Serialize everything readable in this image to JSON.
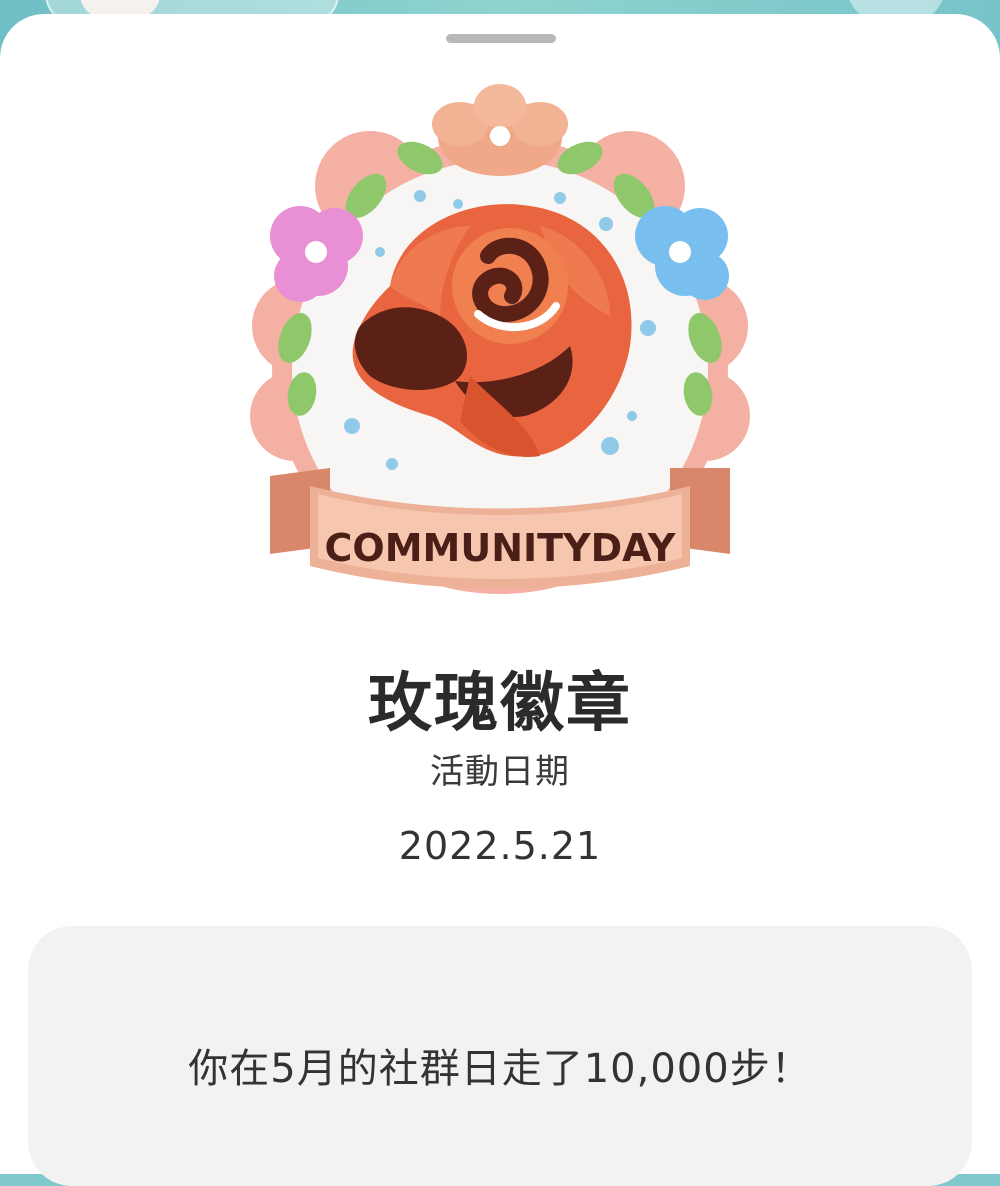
{
  "badge": {
    "name": "玫瑰徽章",
    "ribbon_text": "COMMUNITYDAY",
    "date_label": "活動日期",
    "date_value": "2022.5.21",
    "icon": "rose-community-day-badge"
  },
  "message": {
    "text": "你在5月的社群日走了10,000步！"
  },
  "colors": {
    "header_bg": "#7fc8cc",
    "sheet_bg": "#ffffff",
    "card_bg": "#f2f2f2",
    "rose": "#e9643f",
    "rose_dark": "#5a1f14",
    "ribbon": "#e7a788",
    "frame_pink": "#f1aba0"
  }
}
